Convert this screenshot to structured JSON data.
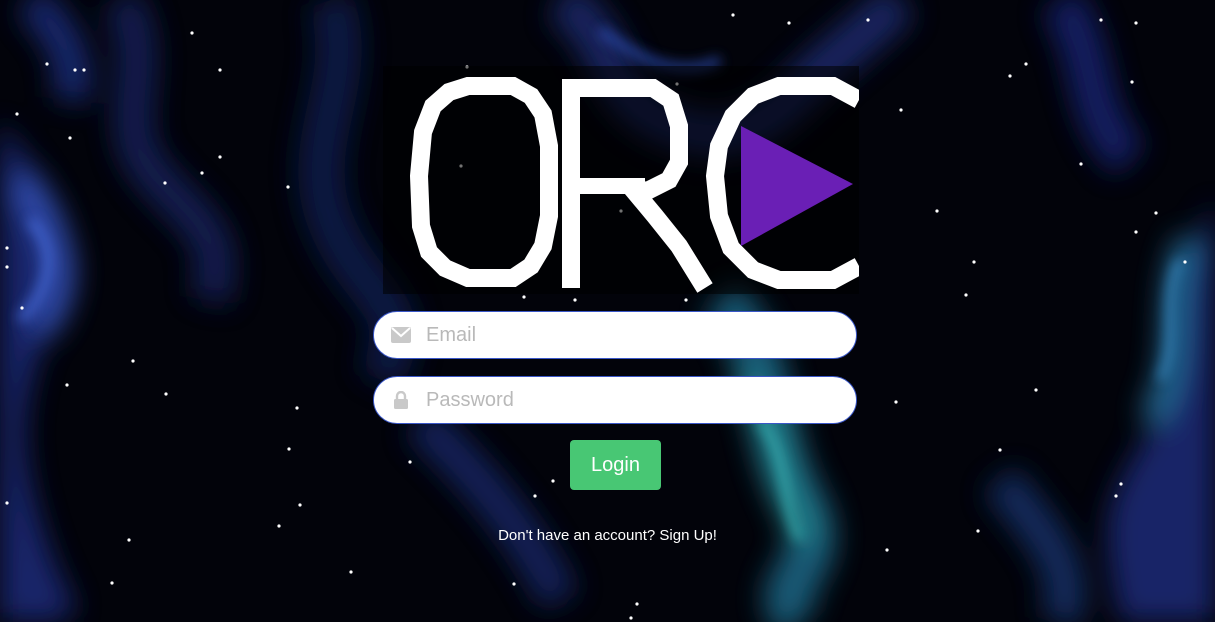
{
  "page": {
    "logo_text": "ORC",
    "accent_color": "#6a1fb5",
    "button_color": "#48c774"
  },
  "form": {
    "email": {
      "placeholder": "Email",
      "value": "",
      "icon": "envelope-icon"
    },
    "password": {
      "placeholder": "Password",
      "value": "",
      "icon": "lock-icon"
    },
    "login_label": "Login",
    "signup_text": "Don't have an account? Sign Up!"
  }
}
